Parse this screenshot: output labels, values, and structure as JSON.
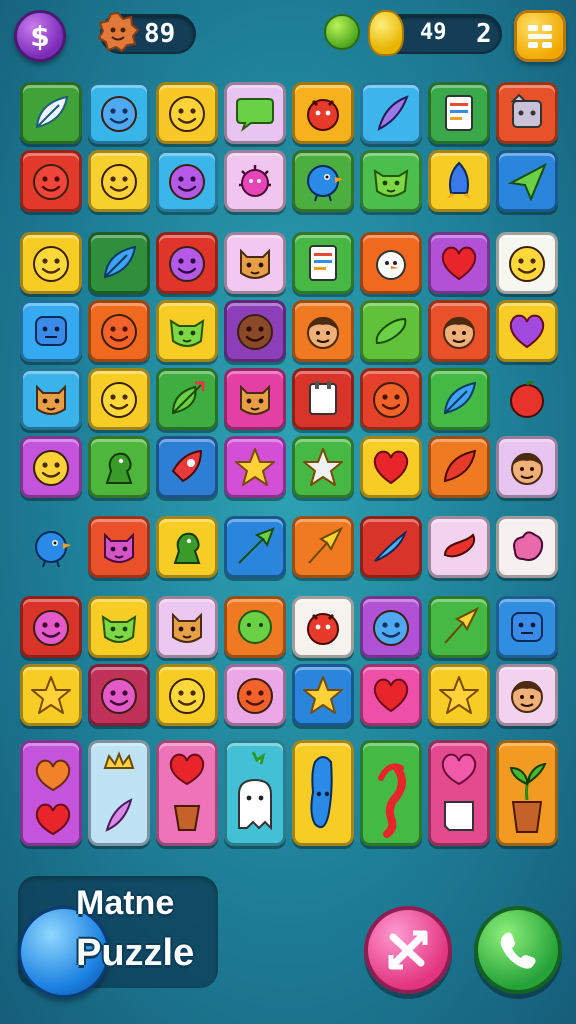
{
  "hud": {
    "currency_symbol": "$",
    "score_left": "89",
    "counter_a": "49",
    "counter_b": "2"
  },
  "title": {
    "line1": "Matne",
    "line2": "Puzzle"
  },
  "colors": {
    "background": "#1e7f96",
    "pink_button": "#e2357f",
    "green_button": "#25a238"
  },
  "board": {
    "columns": 8,
    "tiles": [
      {
        "row": 0,
        "col": 0,
        "color": "#3fa338",
        "icon": "leaf-icon"
      },
      {
        "row": 0,
        "col": 1,
        "color": "#38b6ea",
        "icon": "blue-face-icon"
      },
      {
        "row": 0,
        "col": 2,
        "color": "#f7c826",
        "icon": "yellow-face-icon"
      },
      {
        "row": 0,
        "col": 3,
        "color": "#e8c4f0",
        "icon": "speech-bubble-icon"
      },
      {
        "row": 0,
        "col": 4,
        "color": "#f5b21c",
        "icon": "red-creature-icon"
      },
      {
        "row": 0,
        "col": 5,
        "color": "#3cb4ec",
        "icon": "feather-icon"
      },
      {
        "row": 0,
        "col": 6,
        "color": "#3aa94a",
        "icon": "document-icon"
      },
      {
        "row": 0,
        "col": 7,
        "color": "#e8522a",
        "icon": "robot-face-icon"
      },
      {
        "row": 1,
        "col": 0,
        "color": "#e23a2a",
        "icon": "red-face-icon"
      },
      {
        "row": 1,
        "col": 1,
        "color": "#f6d02c",
        "icon": "yellow-face-icon"
      },
      {
        "row": 1,
        "col": 2,
        "color": "#3bb6ea",
        "icon": "purple-face-icon"
      },
      {
        "row": 1,
        "col": 3,
        "color": "#f0c6ee",
        "icon": "pink-virus-icon"
      },
      {
        "row": 1,
        "col": 4,
        "color": "#4cae3e",
        "icon": "blue-bird-icon"
      },
      {
        "row": 1,
        "col": 5,
        "color": "#4cbe4e",
        "icon": "green-cat-icon"
      },
      {
        "row": 1,
        "col": 6,
        "color": "#f7cd25",
        "icon": "rocket-icon"
      },
      {
        "row": 1,
        "col": 7,
        "color": "#2a86dc",
        "icon": "paper-plane-icon"
      },
      {
        "row": 2,
        "col": 0,
        "color": "#f7cd25",
        "icon": "smiley-icon"
      },
      {
        "row": 2,
        "col": 1,
        "color": "#2f8f3a",
        "icon": "blue-leaf-icon"
      },
      {
        "row": 2,
        "col": 2,
        "color": "#e0362a",
        "icon": "purple-face-icon"
      },
      {
        "row": 2,
        "col": 3,
        "color": "#f2c8f0",
        "icon": "cat-face-icon"
      },
      {
        "row": 2,
        "col": 4,
        "color": "#48b844",
        "icon": "document-icon"
      },
      {
        "row": 2,
        "col": 5,
        "color": "#ef6a1f",
        "icon": "snowman-icon"
      },
      {
        "row": 2,
        "col": 6,
        "color": "#b152d6",
        "icon": "heart-icon"
      },
      {
        "row": 2,
        "col": 7,
        "color": "#f7f7f2",
        "icon": "smiley-icon"
      },
      {
        "row": 3,
        "col": 0,
        "color": "#35aaf0",
        "icon": "blue-square-face-icon"
      },
      {
        "row": 3,
        "col": 1,
        "color": "#ef6a1f",
        "icon": "orange-face-icon"
      },
      {
        "row": 3,
        "col": 2,
        "color": "#f7cd25",
        "icon": "green-cat-icon"
      },
      {
        "row": 3,
        "col": 3,
        "color": "#8c3fb8",
        "icon": "brown-face-icon"
      },
      {
        "row": 3,
        "col": 4,
        "color": "#ef7a22",
        "icon": "boy-face-icon"
      },
      {
        "row": 3,
        "col": 5,
        "color": "#5fc23a",
        "icon": "cucumber-icon"
      },
      {
        "row": 3,
        "col": 6,
        "color": "#e8512a",
        "icon": "boy-face-icon"
      },
      {
        "row": 3,
        "col": 7,
        "color": "#f7cd25",
        "icon": "purple-heart-icon"
      },
      {
        "row": 4,
        "col": 0,
        "color": "#3ab2ea",
        "icon": "cat-face-icon"
      },
      {
        "row": 4,
        "col": 1,
        "color": "#f7cd25",
        "icon": "smiley-icon"
      },
      {
        "row": 4,
        "col": 2,
        "color": "#3fae40",
        "icon": "leaf-arrow-icon"
      },
      {
        "row": 4,
        "col": 3,
        "color": "#e440a4",
        "icon": "cat-face-icon"
      },
      {
        "row": 4,
        "col": 4,
        "color": "#d8342a",
        "icon": "notepad-icon"
      },
      {
        "row": 4,
        "col": 5,
        "color": "#e5412a",
        "icon": "orange-face-icon"
      },
      {
        "row": 4,
        "col": 6,
        "color": "#44b944",
        "icon": "blue-leaf-icon"
      },
      {
        "row": 4,
        "col": 7,
        "color": "#1e7f96",
        "icon": "red-ball-icon",
        "loose": true
      },
      {
        "row": 5,
        "col": 0,
        "color": "#c454dc",
        "icon": "yellow-face-icon"
      },
      {
        "row": 5,
        "col": 1,
        "color": "#4fb63c",
        "icon": "dino-icon"
      },
      {
        "row": 5,
        "col": 2,
        "color": "#2d7fd6",
        "icon": "rocket-red-icon"
      },
      {
        "row": 5,
        "col": 3,
        "color": "#d24fd6",
        "icon": "star-icon"
      },
      {
        "row": 5,
        "col": 4,
        "color": "#46b844",
        "icon": "white-star-icon"
      },
      {
        "row": 5,
        "col": 5,
        "color": "#f7cd25",
        "icon": "heart-icon"
      },
      {
        "row": 5,
        "col": 6,
        "color": "#ef7a22",
        "icon": "red-leaf-icon"
      },
      {
        "row": 5,
        "col": 7,
        "color": "#e8c4f0",
        "icon": "boy-face-icon"
      },
      {
        "row": 6,
        "col": 0,
        "color": "#1e7f96",
        "icon": "blue-bird-icon",
        "loose": true
      },
      {
        "row": 6,
        "col": 1,
        "color": "#e8512a",
        "icon": "pink-cat-icon"
      },
      {
        "row": 6,
        "col": 2,
        "color": "#f7cd25",
        "icon": "dino-icon"
      },
      {
        "row": 6,
        "col": 3,
        "color": "#2a86dc",
        "icon": "green-arrow-icon"
      },
      {
        "row": 6,
        "col": 4,
        "color": "#ef7a22",
        "icon": "yellow-arrow-icon"
      },
      {
        "row": 6,
        "col": 5,
        "color": "#d8342a",
        "icon": "blue-arrow-icon"
      },
      {
        "row": 6,
        "col": 6,
        "color": "#f3d2ef",
        "icon": "sausage-icon"
      },
      {
        "row": 6,
        "col": 7,
        "color": "#f7f0f0",
        "icon": "pink-blob-icon"
      },
      {
        "row": 7,
        "col": 0,
        "color": "#d8342a",
        "icon": "pink-face-icon"
      },
      {
        "row": 7,
        "col": 1,
        "color": "#f7cd25",
        "icon": "green-cat-icon"
      },
      {
        "row": 7,
        "col": 2,
        "color": "#ecc8f0",
        "icon": "cat-face-icon"
      },
      {
        "row": 7,
        "col": 3,
        "color": "#ef7a22",
        "icon": "green-bubble-icon"
      },
      {
        "row": 7,
        "col": 4,
        "color": "#f5f3ee",
        "icon": "red-creature-icon"
      },
      {
        "row": 7,
        "col": 5,
        "color": "#b152d6",
        "icon": "blue-face-icon"
      },
      {
        "row": 7,
        "col": 6,
        "color": "#46b844",
        "icon": "yellow-arrow-icon"
      },
      {
        "row": 7,
        "col": 7,
        "color": "#2f8ee0",
        "icon": "blue-square-face-icon"
      },
      {
        "row": 8,
        "col": 0,
        "color": "#f7cd25",
        "icon": "star-icon"
      },
      {
        "row": 8,
        "col": 1,
        "color": "#c0325a",
        "icon": "pink-face-icon"
      },
      {
        "row": 8,
        "col": 2,
        "color": "#f7cd25",
        "icon": "smiley-icon"
      },
      {
        "row": 8,
        "col": 3,
        "color": "#eaa8e6",
        "icon": "orange-face-icon"
      },
      {
        "row": 8,
        "col": 4,
        "color": "#2a86dc",
        "icon": "star-icon"
      },
      {
        "row": 8,
        "col": 5,
        "color": "#ee4fa8",
        "icon": "heart-icon"
      },
      {
        "row": 8,
        "col": 6,
        "color": "#f7cd25",
        "icon": "star-icon"
      },
      {
        "row": 8,
        "col": 7,
        "color": "#f3d2ef",
        "icon": "boy-face-icon"
      },
      {
        "row": 9,
        "col": 0,
        "color": "#c454dc",
        "icon": "hearts-icon",
        "tall": true
      },
      {
        "row": 9,
        "col": 1,
        "color": "#bfe3f5",
        "icon": "crown-feather-icon",
        "tall": true
      },
      {
        "row": 9,
        "col": 2,
        "color": "#ee74b8",
        "icon": "heart-pot-icon",
        "tall": true
      },
      {
        "row": 9,
        "col": 3,
        "color": "#43c0d6",
        "icon": "ghost-icon",
        "tall": true
      },
      {
        "row": 9,
        "col": 4,
        "color": "#f7cd25",
        "icon": "blue-bean-icon",
        "tall": true
      },
      {
        "row": 9,
        "col": 5,
        "color": "#44b944",
        "icon": "red-hook-icon",
        "tall": true
      },
      {
        "row": 9,
        "col": 6,
        "color": "#e44a8e",
        "icon": "heart-note-icon",
        "tall": true
      },
      {
        "row": 9,
        "col": 7,
        "color": "#f29a22",
        "icon": "plant-pot-icon",
        "tall": true
      }
    ]
  }
}
